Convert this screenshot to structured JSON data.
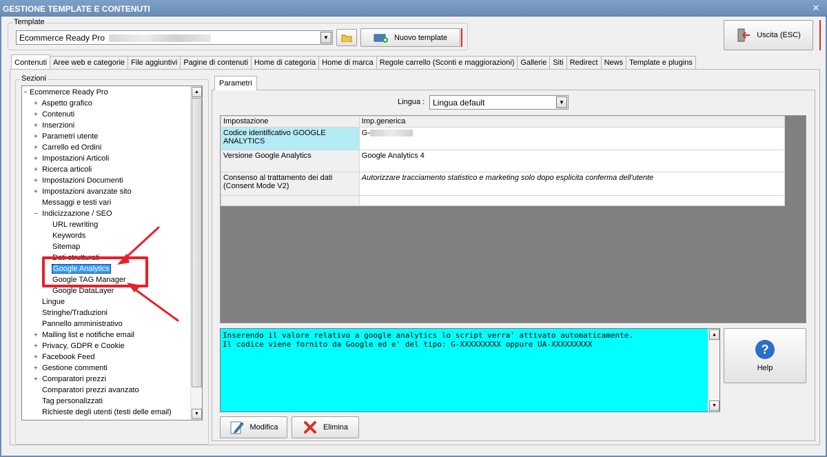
{
  "window": {
    "title": "GESTIONE TEMPLATE E CONTENUTI",
    "close_glyph": "✕"
  },
  "template": {
    "group_label": "Template",
    "selected": "Ecommerce Ready Pro",
    "nuovo_label": "Nuovo template"
  },
  "exit": {
    "label": "Uscita (ESC)"
  },
  "tabs": [
    "Contenuti",
    "Aree web e categorie",
    "File aggiuntivi",
    "Pagine di contenuti",
    "Home di categoria",
    "Home di marca",
    "Regole carrello (Sconti e maggiorazioni)",
    "Gallerie",
    "Siti",
    "Redirect",
    "News",
    "Template e plugins"
  ],
  "sections": {
    "label": "Sezioni",
    "root": "Ecommerce Ready Pro",
    "items": [
      {
        "label": "Aspetto grafico",
        "level": 1,
        "expandable": true
      },
      {
        "label": "Contenuti",
        "level": 1,
        "expandable": true
      },
      {
        "label": "Inserzioni",
        "level": 1,
        "expandable": true
      },
      {
        "label": "Parametri utente",
        "level": 1,
        "expandable": true
      },
      {
        "label": "Carrello ed Ordini",
        "level": 1,
        "expandable": true
      },
      {
        "label": "Impostazioni Articoli",
        "level": 1,
        "expandable": true
      },
      {
        "label": "Ricerca articoli",
        "level": 1,
        "expandable": true
      },
      {
        "label": "Impostazioni Documenti",
        "level": 1,
        "expandable": true
      },
      {
        "label": "Impostazioni avanzate sito",
        "level": 1,
        "expandable": true
      },
      {
        "label": "Messaggi e testi vari",
        "level": 1,
        "expandable": false
      },
      {
        "label": "Indicizzazione / SEO",
        "level": 1,
        "expandable": true,
        "expanded": true
      },
      {
        "label": "URL rewriting",
        "level": 2,
        "expandable": false
      },
      {
        "label": "Keywords",
        "level": 2,
        "expandable": false
      },
      {
        "label": "Sitemap",
        "level": 2,
        "expandable": false
      },
      {
        "label": "Dati strutturati",
        "level": 2,
        "expandable": false
      },
      {
        "label": "Google Analytics",
        "level": 2,
        "expandable": false,
        "selected": true
      },
      {
        "label": "Google TAG Manager",
        "level": 2,
        "expandable": false
      },
      {
        "label": "Google DataLayer",
        "level": 2,
        "expandable": false
      },
      {
        "label": "Lingue",
        "level": 1,
        "expandable": false
      },
      {
        "label": "Stringhe/Traduzioni",
        "level": 1,
        "expandable": false
      },
      {
        "label": "Pannello amministrativo",
        "level": 1,
        "expandable": false
      },
      {
        "label": "Mailing list e notifiche email",
        "level": 1,
        "expandable": true
      },
      {
        "label": "Privacy, GDPR e Cookie",
        "level": 1,
        "expandable": true
      },
      {
        "label": "Facebook Feed",
        "level": 1,
        "expandable": true
      },
      {
        "label": "Gestione commenti",
        "level": 1,
        "expandable": true
      },
      {
        "label": "Comparatori prezzi",
        "level": 1,
        "expandable": true
      },
      {
        "label": "Comparatori prezzi avanzato",
        "level": 1,
        "expandable": false
      },
      {
        "label": "Tag personalizzati",
        "level": 1,
        "expandable": false
      },
      {
        "label": "Richieste degli utenti (testi delle email)",
        "level": 1,
        "expandable": false
      }
    ]
  },
  "params": {
    "tab_label": "Parametri",
    "lingua_label": "Lingua :",
    "lingua_value": "Lingua default",
    "grid": {
      "headers": [
        "Impostazione",
        "Imp.generica"
      ],
      "rows": [
        {
          "setting": "Codice identificativo GOOGLE ANALYTICS",
          "value": "G-"
        },
        {
          "setting": "Versione Google Analytics",
          "value": "Google Analytics 4"
        },
        {
          "setting": "Consenso al trattamento dei dati (Consent Mode V2)",
          "value": "Autorizzare tracciamento statistico e marketing solo dopo esplicita conferma dell'utente"
        },
        {
          "setting": "",
          "value": ""
        }
      ]
    },
    "description": [
      "Inserendo il valore relativo a google analytics lo script verra' attivato automaticamente.",
      "Il codice viene fornito da Google ed e' del tipo: G-XXXXXXXXX oppure UA-XXXXXXXXX"
    ],
    "help_label": "Help",
    "modifica_label": "Modifica",
    "elimina_label": "Elimina"
  },
  "colors": {
    "highlight_cyan": "#00ffff",
    "selected_cell": "#b4ecf5",
    "annotation_red": "#e8202a",
    "titlebar": "#6b8cb6"
  }
}
